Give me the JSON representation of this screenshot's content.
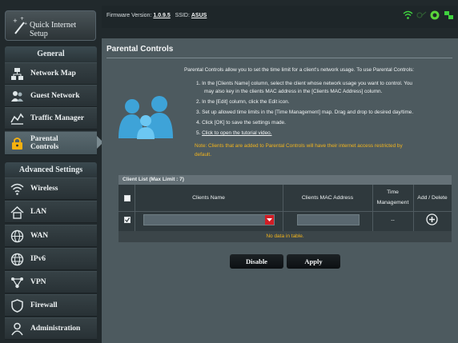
{
  "header": {
    "quick_setup": "Quick Internet Setup",
    "firmware_label": "Firmware Version:",
    "firmware_value": "1.0.9.5",
    "ssid_label": "SSID:",
    "ssid_value": "ASUS"
  },
  "sidebar": {
    "general_title": "General",
    "items": [
      {
        "label": "Network Map"
      },
      {
        "label": "Guest Network"
      },
      {
        "label": "Traffic Manager"
      },
      {
        "label1": "Parental",
        "label2": "Controls"
      }
    ],
    "advanced_title": "Advanced Settings",
    "advanced_items": [
      {
        "label": "Wireless"
      },
      {
        "label": "LAN"
      },
      {
        "label": "WAN"
      },
      {
        "label": "IPv6"
      },
      {
        "label": "VPN"
      },
      {
        "label": "Firewall"
      },
      {
        "label": "Administration"
      }
    ]
  },
  "main": {
    "title": "Parental Controls",
    "intro": "Parental Controls allow you to set the time limit for a client's network usage. To use Parental Controls:",
    "steps": [
      "1. In the [Clients Name] column, select the client whose network usage you want to control. You",
      "may also key in the clients MAC address in the [Clients MAC Address] column.",
      "2. In the [Edit] column, click the Edit icon.",
      "3. Set up allowed time limits in the [Time Management] map. Drag and drop to desired day/time.",
      "4. Click [OK] to save the settings made.",
      "5. "
    ],
    "tutorial_link": "Click to open the tutorial video.",
    "note_line1": "Note: Clients that are added to Parental Controls will have their internet access restricted by",
    "note_line2": "default."
  },
  "table": {
    "title": "Client List (Max Limit : 7)",
    "headers": {
      "name": "Clients Name",
      "mac": "Clients MAC Address",
      "time1": "Time",
      "time2": "Management",
      "add": "Add / Delete"
    },
    "row_time": "--",
    "no_data": "No data in table."
  },
  "buttons": {
    "disable": "Disable",
    "apply": "Apply"
  },
  "colors": {
    "accent_warning": "#f2b41d",
    "active_item": "#46555b"
  }
}
